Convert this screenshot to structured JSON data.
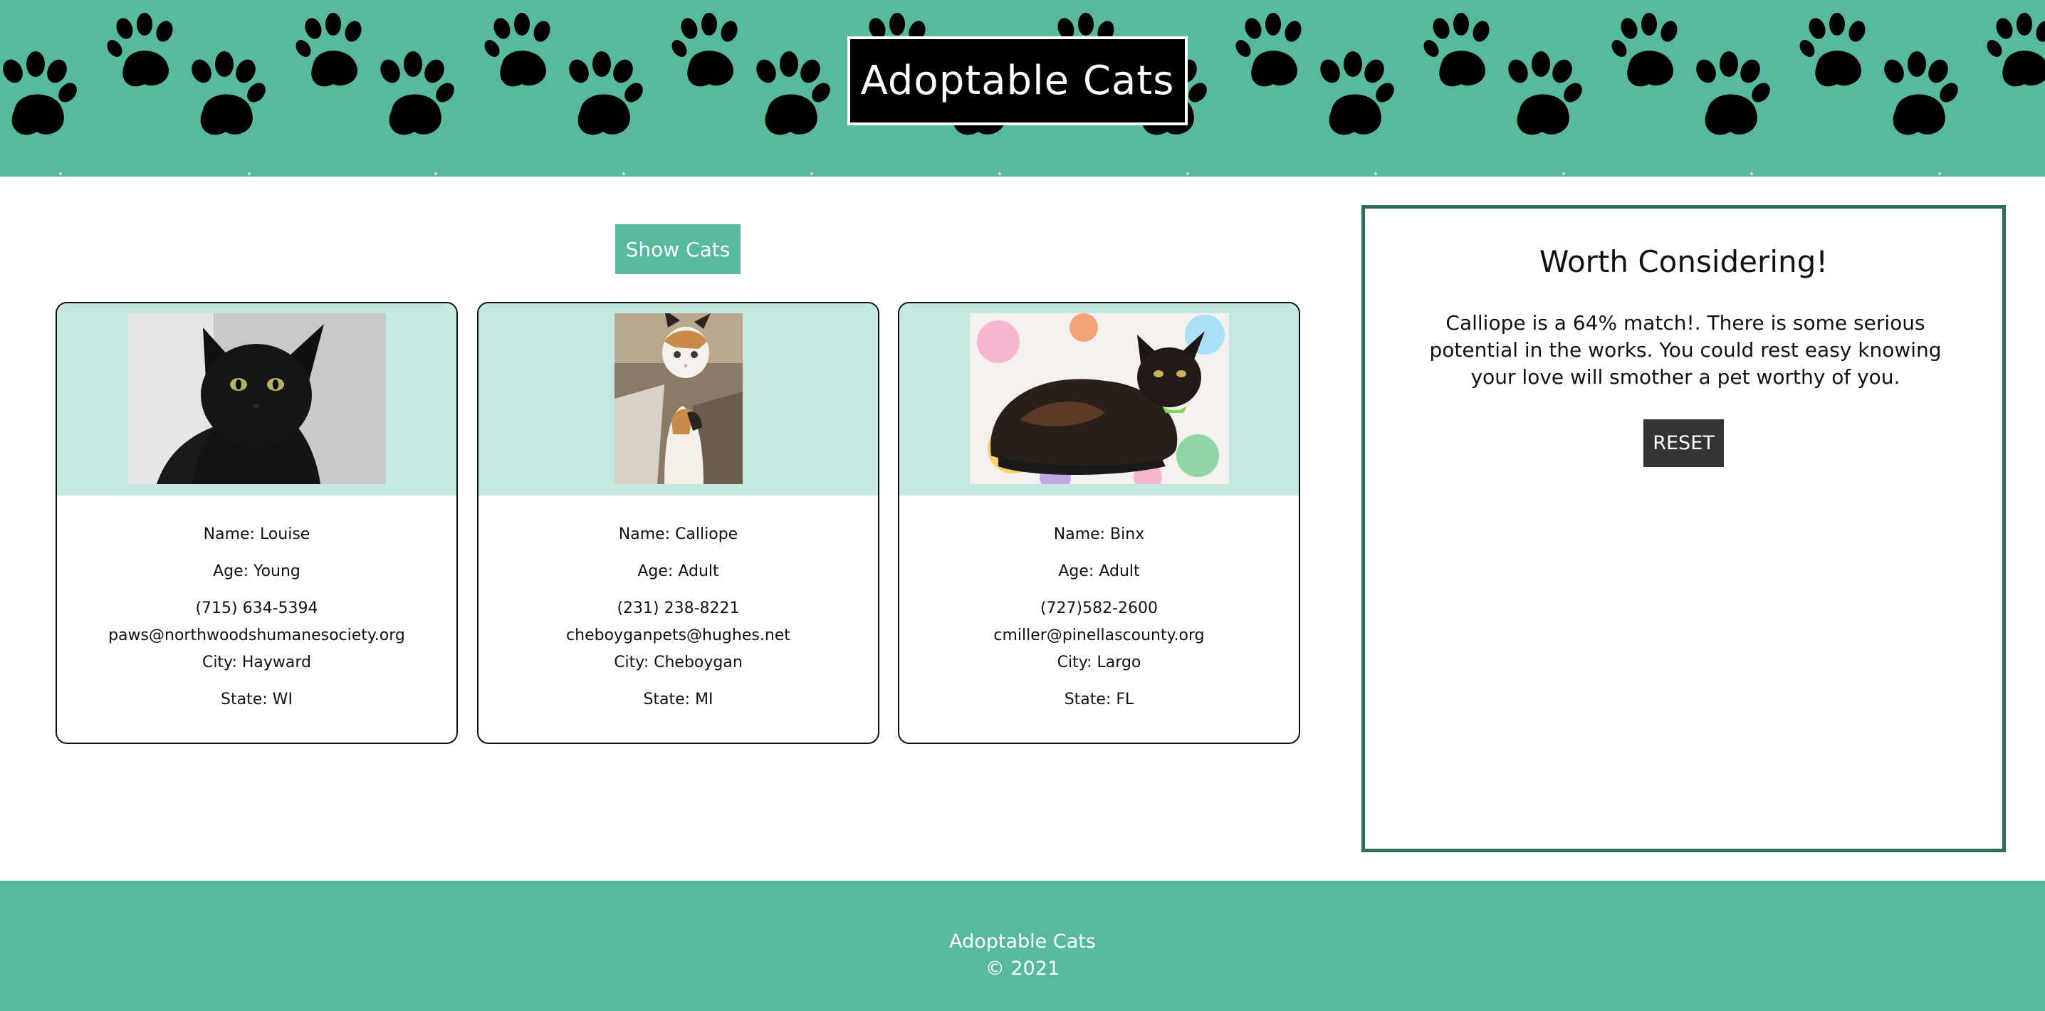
{
  "header": {
    "title": "Adoptable Cats",
    "pattern_icon": "paw-print-icon",
    "background_color": "#57b99d"
  },
  "controls": {
    "show_cats_label": "Show Cats"
  },
  "cats": [
    {
      "name": "Name: Louise",
      "age": "Age: Young",
      "phone": "(715) 634-5394",
      "email": "paws@northwoodshumanesociety.org",
      "city": "City: Hayward",
      "state": "State: WI",
      "photo": "black-cat-photo"
    },
    {
      "name": "Name: Calliope",
      "age": "Age: Adult",
      "phone": "(231) 238-8221",
      "email": "cheboyganpets@hughes.net",
      "city": "City: Cheboygan",
      "state": "State: MI",
      "photo": "calico-cat-photo"
    },
    {
      "name": "Name: Binx",
      "age": "Age: Adult",
      "phone": "(727)582-2600",
      "email": "cmiller@pinellascounty.org",
      "city": "City: Largo",
      "state": "State: FL",
      "photo": "tortoiseshell-cat-photo"
    }
  ],
  "panel": {
    "title": "Worth Considering!",
    "message": "Calliope is a 64% match!. There is some serious potential in the works. You could rest easy knowing your love will smother a pet worthy of you.",
    "reset_label": "RESET",
    "border_color": "#2e6e58"
  },
  "footer": {
    "line1": "Adoptable Cats",
    "line2": "© 2021"
  }
}
